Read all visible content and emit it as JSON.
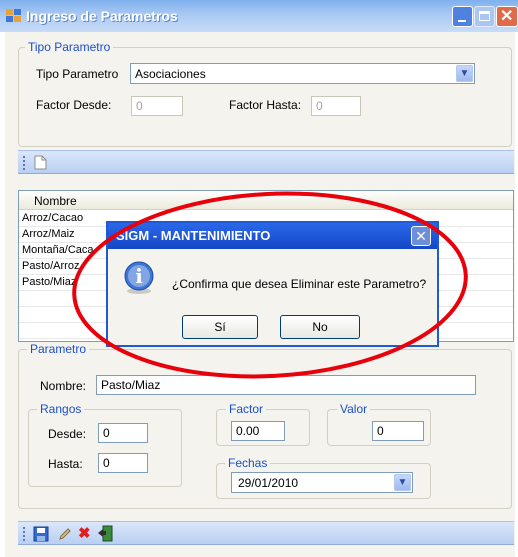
{
  "window": {
    "title": "Ingreso de Parametros"
  },
  "tipo_parametro": {
    "group_label": "Tipo Parametro",
    "tipo_label": "Tipo Parametro",
    "tipo_value": "Asociaciones",
    "factor_desde_label": "Factor Desde:",
    "factor_desde_value": "0",
    "factor_hasta_label": "Factor Hasta:",
    "factor_hasta_value": "0"
  },
  "list": {
    "header": "Nombre",
    "rows": [
      "Arroz/Cacao",
      "Arroz/Maiz",
      "Montaña/Caca",
      "Pasto/Arroz",
      "Pasto/Miaz"
    ]
  },
  "parametro": {
    "group_label": "Parametro",
    "nombre_label": "Nombre:",
    "nombre_value": "Pasto/Miaz",
    "rangos_label": "Rangos",
    "desde_label": "Desde:",
    "desde_value": "0",
    "hasta_label": "Hasta:",
    "hasta_value": "0",
    "factor_label": "Factor",
    "factor_value": "0.00",
    "valor_label": "Valor",
    "valor_value": "0",
    "fechas_label": "Fechas",
    "fecha_value": "29/01/2010"
  },
  "dialog": {
    "title": "SIGM - MANTENIMIENTO",
    "message": "¿Confirma que desea Eliminar este Parametro?",
    "yes_label": "Sí",
    "no_label": "No"
  },
  "colors": {
    "annotation": "#e8000b",
    "accent": "#1e59d8"
  }
}
